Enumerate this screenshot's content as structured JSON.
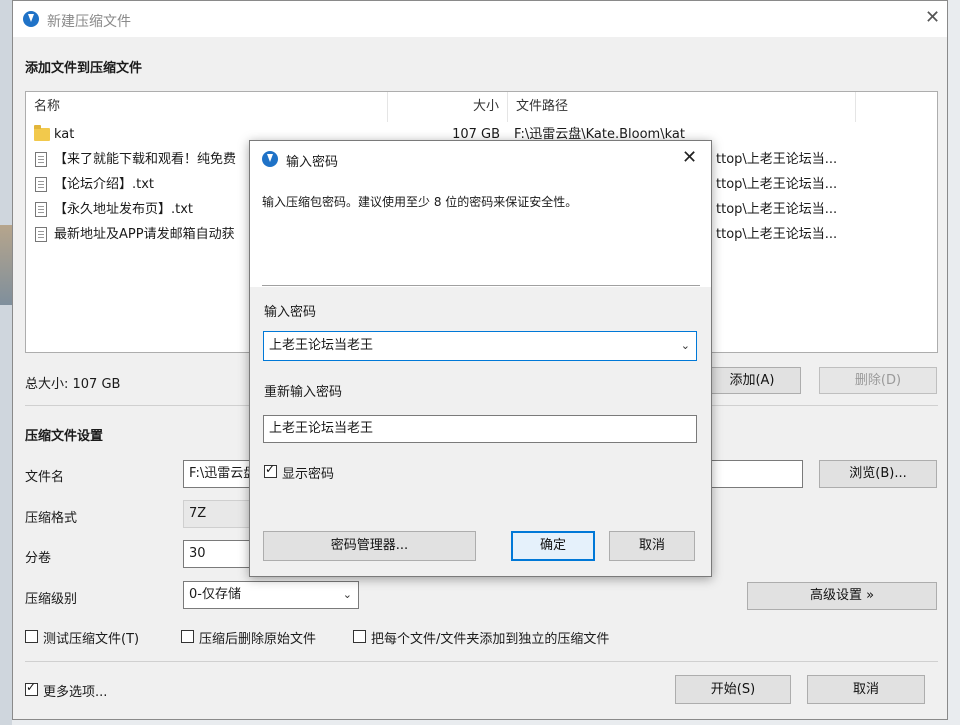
{
  "main_window": {
    "title": "新建压缩文件",
    "add_section_title": "添加文件到压缩文件",
    "columns": {
      "name": "名称",
      "size": "大小",
      "path": "文件路径"
    },
    "files": [
      {
        "icon": "folder-icon",
        "name": "kat",
        "size": "107 GB",
        "path": "F:\\迅雷云盘\\Kate.Bloom\\kat"
      },
      {
        "icon": "text-file-icon",
        "name": "【来了就能下载和观看！纯免费",
        "size": "",
        "path": "ttop\\上老王论坛当..."
      },
      {
        "icon": "text-file-icon",
        "name": "【论坛介绍】.txt",
        "size": "",
        "path": "ttop\\上老王论坛当..."
      },
      {
        "icon": "text-file-icon",
        "name": "【永久地址发布页】.txt",
        "size": "",
        "path": "ttop\\上老王论坛当..."
      },
      {
        "icon": "text-file-icon",
        "name": "最新地址及APP请发邮箱自动获",
        "size": "",
        "path": "ttop\\上老王论坛当..."
      }
    ],
    "total_size": "总大小: 107 GB",
    "add_button": "添加(A)",
    "delete_button": "删除(D)",
    "settings_title": "压缩文件设置",
    "filename_label": "文件名",
    "filename_value": "F:\\迅雷云盘",
    "browse_button": "浏览(B)...",
    "format_label": "压缩格式",
    "format_value": "7Z",
    "split_label": "分卷",
    "split_value": "30",
    "level_label": "压缩级别",
    "level_value": "0-仅存储",
    "advanced_button": "高级设置 »",
    "test_archive": "测试压缩文件(T)",
    "delete_originals": "压缩后删除原始文件",
    "separate_archives": "把每个文件/文件夹添加到独立的压缩文件",
    "more_options": "更多选项...",
    "start_button": "开始(S)",
    "cancel_button": "取消"
  },
  "password_dialog": {
    "title": "输入密码",
    "description": "输入压缩包密码。建议使用至少 8 位的密码来保证安全性。",
    "password_label": "输入密码",
    "password_value": "上老王论坛当老王",
    "confirm_label": "重新输入密码",
    "confirm_value": "上老王论坛当老王",
    "show_password": "显示密码",
    "manager_button": "密码管理器...",
    "ok_button": "确定",
    "cancel_button": "取消"
  }
}
